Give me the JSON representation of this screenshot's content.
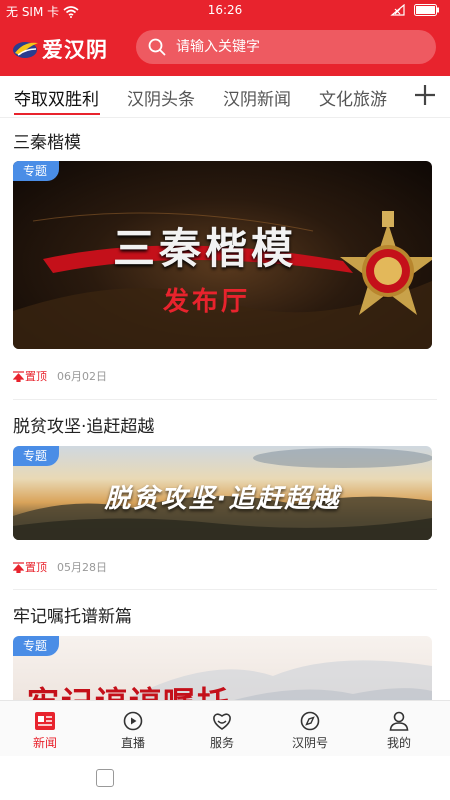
{
  "status_bar": {
    "carrier": "无 SIM 卡",
    "time": "16:26"
  },
  "app": {
    "logo_text": "爱汉阴",
    "search_placeholder": "请输入关键字"
  },
  "tabs": [
    {
      "label": "夺取双胜利",
      "active": true
    },
    {
      "label": "汉阴头条",
      "active": false
    },
    {
      "label": "汉阴新闻",
      "active": false
    },
    {
      "label": "文化旅游",
      "active": false
    }
  ],
  "feed": [
    {
      "title": "三秦楷模",
      "tag": "专题",
      "banner_text": "三秦楷模",
      "banner_subtext": "发布厅",
      "pin_label": "置顶",
      "date": "06月02日"
    },
    {
      "title": "脱贫攻坚·追赶超越",
      "tag": "专题",
      "banner_text": "脱贫攻坚·追赶超越",
      "pin_label": "置顶",
      "date": "05月28日"
    },
    {
      "title": "牢记嘱托谱新篇",
      "tag": "专题",
      "banner_text": "牢记谆谆嘱托"
    }
  ],
  "bottom_nav": [
    {
      "label": "新闻",
      "icon": "news-icon",
      "active": true
    },
    {
      "label": "直播",
      "icon": "play-icon",
      "active": false
    },
    {
      "label": "服务",
      "icon": "service-icon",
      "active": false
    },
    {
      "label": "汉阴号",
      "icon": "compass-icon",
      "active": false
    },
    {
      "label": "我的",
      "icon": "user-icon",
      "active": false
    }
  ],
  "colors": {
    "brand_red": "#e8232d",
    "tag_blue": "#4a8de6"
  }
}
